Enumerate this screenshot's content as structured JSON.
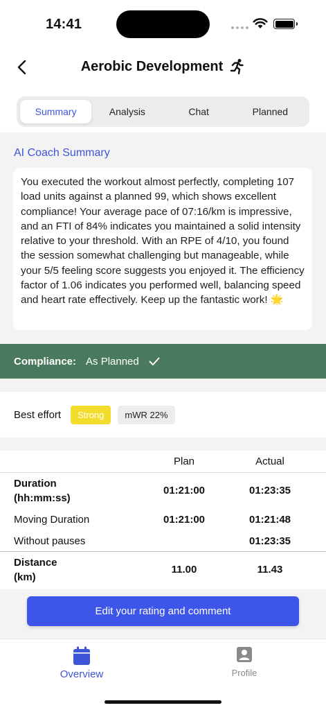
{
  "status_bar": {
    "time": "14:41"
  },
  "header": {
    "title": "Aerobic Development",
    "activity_icon": "running-person-icon"
  },
  "tabs": [
    {
      "label": "Summary",
      "active": true
    },
    {
      "label": "Analysis",
      "active": false
    },
    {
      "label": "Chat",
      "active": false
    },
    {
      "label": "Planned",
      "active": false
    }
  ],
  "summary": {
    "heading": "AI Coach Summary",
    "text": "You executed the workout almost perfectly, completing 107 load units against a planned 99, which shows excellent compliance! Your average pace of 07:16/km is impressive, and an FTI of 84% indicates you maintained a solid intensity relative to your threshold. With an RPE of 4/10, you found the session somewhat challenging but manageable, while your 5/5 feeling score suggests you enjoyed it. The efficiency factor of 1.06 indicates you performed well, balancing speed and heart rate effectively. Keep up the fantastic work! 🌟"
  },
  "compliance": {
    "label": "Compliance:",
    "value": "As Planned",
    "color": "#4a7a5e"
  },
  "best_effort": {
    "label": "Best effort",
    "badge": "Strong",
    "badge_color": "#f2dc2c",
    "mwr": "mWR 22%"
  },
  "metrics_table": {
    "headers": {
      "plan": "Plan",
      "actual": "Actual"
    },
    "rows": [
      {
        "label_line1": "Duration",
        "label_line2": "(hh:mm:ss)",
        "plan": "01:21:00",
        "actual": "01:23:35"
      },
      {
        "label": "Moving Duration",
        "plan": "01:21:00",
        "actual": "01:21:48"
      },
      {
        "label": "Without pauses",
        "plan": "",
        "actual": "01:23:35"
      },
      {
        "label_line1": "Distance",
        "label_line2": "(km)",
        "plan": "11.00",
        "actual": "11.43"
      }
    ]
  },
  "edit_button": {
    "label": "Edit your rating and comment",
    "color": "#3d55e8"
  },
  "bottom_nav": {
    "overview": {
      "label": "Overview",
      "icon": "calendar-icon",
      "active": true
    },
    "profile": {
      "label": "Profile",
      "icon": "profile-icon",
      "active": false
    }
  },
  "accent_color": "#3d55d6"
}
